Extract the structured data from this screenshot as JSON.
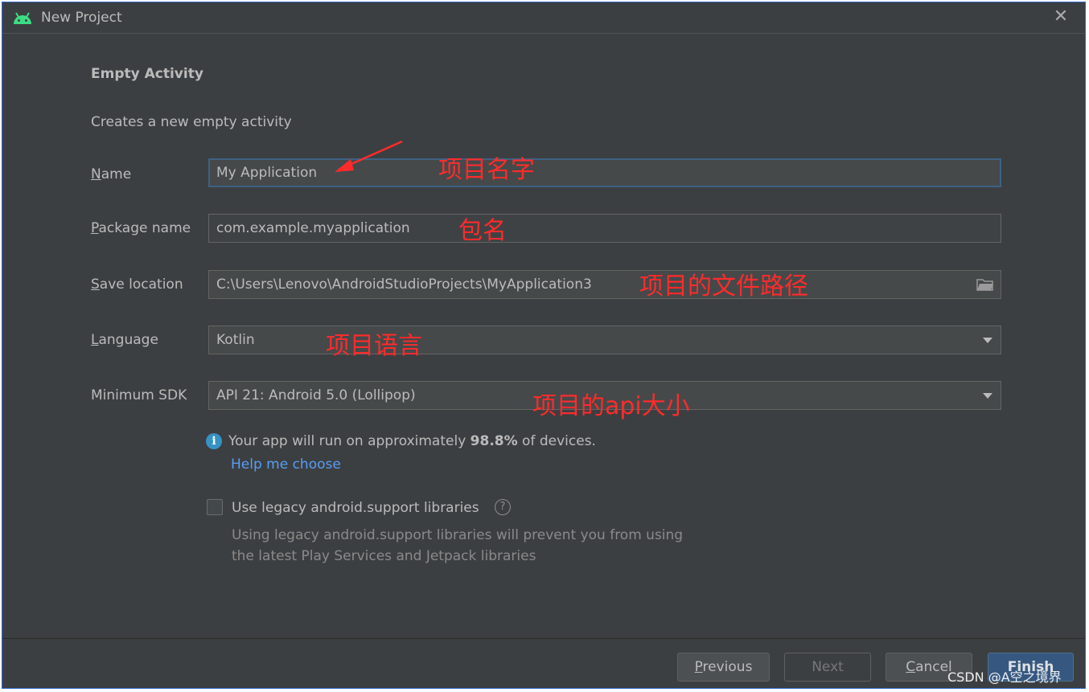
{
  "window": {
    "title": "New Project",
    "close_glyph": "✕"
  },
  "content": {
    "heading": "Empty Activity",
    "description": "Creates a new empty activity"
  },
  "form": {
    "name": {
      "label_accel": "N",
      "label_rest": "ame",
      "value": "My Application"
    },
    "package": {
      "label_accel": "P",
      "label_rest": "ackage name",
      "value": "com.example.myapplication"
    },
    "save_location": {
      "label_accel": "S",
      "label_rest": "ave location",
      "value": "C:\\Users\\Lenovo\\AndroidStudioProjects\\MyApplication3",
      "icon": "folder-icon"
    },
    "language": {
      "label_accel": "L",
      "label_rest": "anguage",
      "value": "Kotlin"
    },
    "min_sdk": {
      "label": "Minimum SDK",
      "value": "API 21: Android 5.0 (Lollipop)"
    }
  },
  "info": {
    "icon_glyph": "i",
    "text_before": "Your app will run on approximately ",
    "percent": "98.8%",
    "text_after": " of devices.",
    "help_link": "Help me choose"
  },
  "legacy": {
    "checkbox_label": "Use legacy android.support libraries",
    "checked": false,
    "help_glyph": "?",
    "note_line1": "Using legacy android.support libraries will prevent you from using",
    "note_line2": "the latest Play Services and Jetpack libraries"
  },
  "buttons": {
    "previous": {
      "accel": "P",
      "rest": "revious"
    },
    "next": "Next",
    "cancel": {
      "accel": "C",
      "rest": "ancel"
    },
    "finish": "Finish"
  },
  "annotations": {
    "name": "项目名字",
    "package": "包名",
    "location": "项目的文件路径",
    "language": "项目语言",
    "sdk": "项目的api大小"
  },
  "watermark": "CSDN @A空之境界",
  "colors": {
    "background": "#3c3f41",
    "field": "#45494a",
    "link": "#589df6",
    "annotation": "#ff2b2b",
    "primary_button": "#365880",
    "android_green": "#3ddc84"
  }
}
